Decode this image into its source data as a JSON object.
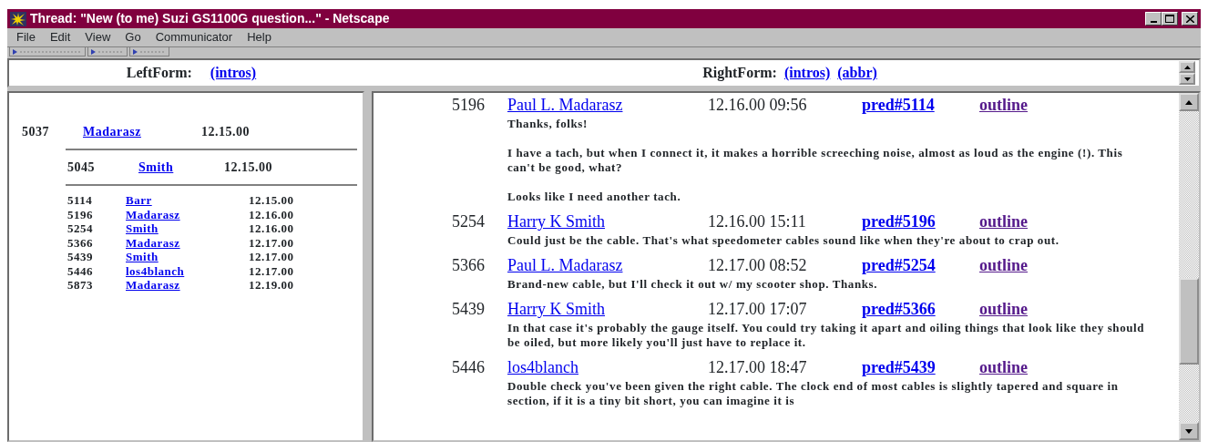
{
  "window": {
    "title": "Thread: \"New (to me) Suzi GS1100G question...\" - Netscape"
  },
  "menu": [
    "File",
    "Edit",
    "View",
    "Go",
    "Communicator",
    "Help"
  ],
  "left_form": {
    "label": "LeftForm:",
    "links": [
      {
        "label": "(intros)",
        "visited": false
      }
    ]
  },
  "right_form": {
    "label": "RightForm:",
    "links": [
      {
        "label": "(intros)",
        "visited": false
      },
      {
        "label": "(abbr)",
        "visited": false
      }
    ]
  },
  "thread": {
    "id": "5037",
    "author": "Madarasz",
    "date": "12.15.00",
    "children": [
      {
        "id": "5045",
        "author": "Smith",
        "date": "12.15.00",
        "children": [
          {
            "id": "5114",
            "author": "Barr",
            "date": "12.15.00"
          },
          {
            "id": "5196",
            "author": "Madarasz",
            "date": "12.16.00"
          },
          {
            "id": "5254",
            "author": "Smith",
            "date": "12.16.00"
          },
          {
            "id": "5366",
            "author": "Madarasz",
            "date": "12.17.00"
          },
          {
            "id": "5439",
            "author": "Smith",
            "date": "12.17.00"
          },
          {
            "id": "5446",
            "author": "los4blanch",
            "date": "12.17.00"
          },
          {
            "id": "5873",
            "author": "Madarasz",
            "date": "12.19.00"
          }
        ]
      }
    ]
  },
  "messages": [
    {
      "id": "5196",
      "author": "Paul L. Madarasz",
      "datetime": "12.16.00 09:56",
      "pred": {
        "label": "pred#5114",
        "visited": false
      },
      "outline": {
        "label": "outline",
        "visited": true
      },
      "body": [
        "Thanks, folks!",
        "I have a tach, but when I connect it, it makes a horrible screeching noise, almost as loud as the engine (!). This can't be good, what?",
        "Looks like I need another tach."
      ]
    },
    {
      "id": "5254",
      "author": "Harry K Smith",
      "datetime": "12.16.00 15:11",
      "pred": {
        "label": "pred#5196",
        "visited": false
      },
      "outline": {
        "label": "outline",
        "visited": true
      },
      "body": [
        "Could just be the cable. That's what speedometer cables sound like when they're about to crap out."
      ]
    },
    {
      "id": "5366",
      "author": "Paul L. Madarasz",
      "datetime": "12.17.00 08:52",
      "pred": {
        "label": "pred#5254",
        "visited": false
      },
      "outline": {
        "label": "outline",
        "visited": true
      },
      "body": [
        "Brand-new cable, but I'll check it out w/ my scooter shop. Thanks."
      ]
    },
    {
      "id": "5439",
      "author": "Harry K Smith",
      "datetime": "12.17.00 17:07",
      "pred": {
        "label": "pred#5366",
        "visited": false
      },
      "outline": {
        "label": "outline",
        "visited": true
      },
      "body": [
        "In that case it's probably the gauge itself. You could try taking it apart and oiling things that look like they should be oiled, but more likely you'll just have to replace it."
      ]
    },
    {
      "id": "5446",
      "author": "los4blanch",
      "datetime": "12.17.00 18:47",
      "pred": {
        "label": "pred#5439",
        "visited": false
      },
      "outline": {
        "label": "outline",
        "visited": true
      },
      "body": [
        "Double check you've been given the right cable. The clock end of most cables is slightly tapered and square in section, if it is a tiny bit short, you can imagine it is"
      ]
    }
  ]
}
